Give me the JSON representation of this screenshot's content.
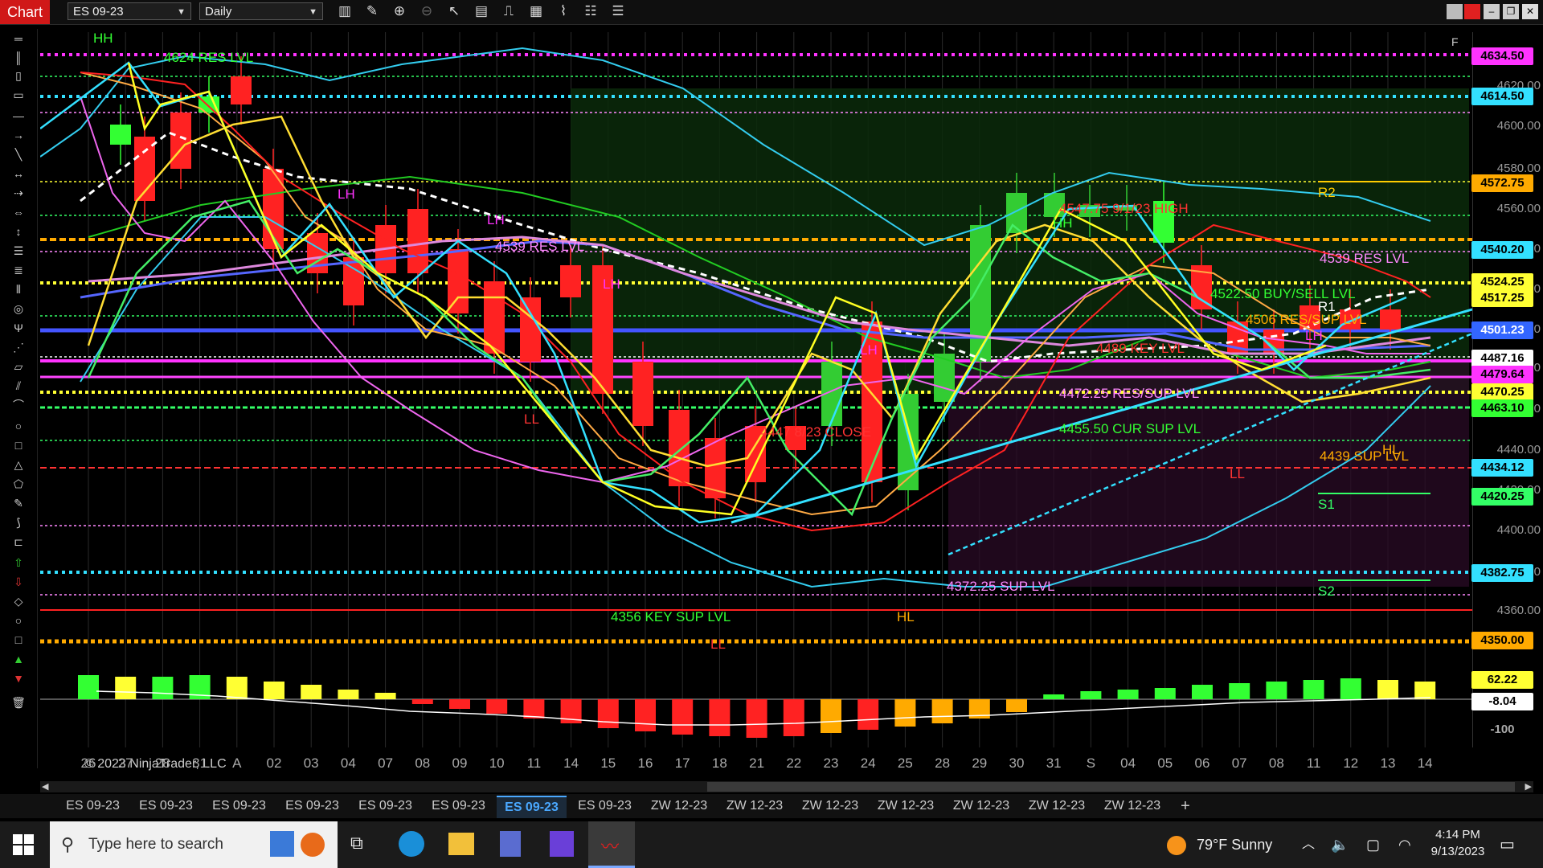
{
  "window": {
    "app_tab": "Chart",
    "instrument": "ES 09-23",
    "interval": "Daily",
    "controls": [
      "minimize",
      "restore",
      "close"
    ]
  },
  "toolbar": {
    "icons": [
      "bars-icon",
      "pencil-icon",
      "zoom-in-icon",
      "zoom-out-icon",
      "pointer-icon",
      "data-box-icon",
      "strategy-icon",
      "indicators-icon",
      "chart-trader-icon",
      "properties-icon",
      "list-icon"
    ]
  },
  "price_axis": {
    "labels": [
      "4620.00",
      "4600.00",
      "4580.00",
      "4560.00",
      "4540.00",
      "4520.00",
      "4500.00",
      "4480.00",
      "4460.00",
      "4440.00",
      "4420.00",
      "4400.00",
      "4380.00",
      "4360.00"
    ],
    "boxes": [
      {
        "text": "4634.50",
        "bg": "#ff33ff"
      },
      {
        "text": "4614.50",
        "bg": "#33e0ff"
      },
      {
        "text": "4572.75",
        "bg": "#ffaa00"
      },
      {
        "text": "4540.20",
        "bg": "#33e0ff"
      },
      {
        "text": "4524.25",
        "bg": "#ffff33"
      },
      {
        "text": "4517.25",
        "bg": "#ffff33"
      },
      {
        "text": "4501.23",
        "bg": "#3366ff"
      },
      {
        "text": "4487.16",
        "bg": "#ffffff"
      },
      {
        "text": "4479.64",
        "bg": "#ff33ff"
      },
      {
        "text": "4470.25",
        "bg": "#ffff33"
      },
      {
        "text": "4463.10",
        "bg": "#33ff33"
      },
      {
        "text": "4434.12",
        "bg": "#33e0ff"
      },
      {
        "text": "4420.25",
        "bg": "#33ff66"
      },
      {
        "text": "4382.75",
        "bg": "#33e0ff"
      },
      {
        "text": "4350.00",
        "bg": "#ffaa00"
      }
    ]
  },
  "oscillator": {
    "labels": [
      "62.22",
      "-8.04",
      "-100"
    ]
  },
  "date_axis": [
    "26",
    "27",
    "28",
    "31",
    "A",
    "02",
    "03",
    "04",
    "07",
    "08",
    "09",
    "10",
    "11",
    "14",
    "15",
    "16",
    "17",
    "18",
    "21",
    "22",
    "23",
    "24",
    "25",
    "28",
    "29",
    "30",
    "31",
    "S",
    "04",
    "05",
    "06",
    "07",
    "08",
    "11",
    "12",
    "13",
    "14"
  ],
  "annotations": [
    {
      "text": "4624 RES LVL",
      "color": "#33ff33"
    },
    {
      "text": "HH",
      "color": "#33ff33"
    },
    {
      "text": "LH",
      "color": "#ff33ff"
    },
    {
      "text": "LH",
      "color": "#ff33ff"
    },
    {
      "text": "4539 RES LVL",
      "color": "#ff88ff"
    },
    {
      "text": "LH",
      "color": "#ff33ff"
    },
    {
      "text": "LL",
      "color": "#ff3333"
    },
    {
      "text": "4447 8/23 CLOSE",
      "color": "#ff3333"
    },
    {
      "text": "LH",
      "color": "#ff33ff"
    },
    {
      "text": "4356 KEY SUP LVL",
      "color": "#33ff33"
    },
    {
      "text": "LL",
      "color": "#ff3333"
    },
    {
      "text": "HL",
      "color": "#ffaa00"
    },
    {
      "text": "4372.25 SUP LVL",
      "color": "#ff88ff"
    },
    {
      "text": "4547.75 9/1/23 HIGH",
      "color": "#ff3333"
    },
    {
      "text": "HH",
      "color": "#33ff33"
    },
    {
      "text": "4522.50 BUY/SELL LVL",
      "color": "#33ff33"
    },
    {
      "text": "4506 RES/SUP LVL",
      "color": "#ffaa00"
    },
    {
      "text": "4489 KEY LVL",
      "color": "#ff3333"
    },
    {
      "text": "4472.25 RES/SUP LVL",
      "color": "#ff88ff"
    },
    {
      "text": "4455.50 CUR SUP LVL",
      "color": "#33ff33"
    },
    {
      "text": "4439 SUP LVL",
      "color": "#ffaa00"
    },
    {
      "text": "4539 RES LVL",
      "color": "#ff88ff"
    },
    {
      "text": "LH",
      "color": "#ff33ff"
    },
    {
      "text": "LL",
      "color": "#ff3333"
    },
    {
      "text": "HL",
      "color": "#ffaa00"
    },
    {
      "text": "R2",
      "color": "#ffcc00"
    },
    {
      "text": "R1",
      "color": "#ffffff"
    },
    {
      "text": "S1",
      "color": "#33ff66"
    },
    {
      "text": "S2",
      "color": "#33ff66"
    },
    {
      "text": "F",
      "color": "#cccccc"
    }
  ],
  "copyright": "© 2023 NinjaTrader, LLC",
  "instrument_tabs": [
    {
      "label": "ES 09-23",
      "active": false
    },
    {
      "label": "ES 09-23",
      "active": false
    },
    {
      "label": "ES 09-23",
      "active": false
    },
    {
      "label": "ES 09-23",
      "active": false
    },
    {
      "label": "ES 09-23",
      "active": false
    },
    {
      "label": "ES 09-23",
      "active": false
    },
    {
      "label": "ES 09-23",
      "active": true
    },
    {
      "label": "ES 09-23",
      "active": false
    },
    {
      "label": "ZW 12-23",
      "active": false
    },
    {
      "label": "ZW 12-23",
      "active": false
    },
    {
      "label": "ZW 12-23",
      "active": false
    },
    {
      "label": "ZW 12-23",
      "active": false
    },
    {
      "label": "ZW 12-23",
      "active": false
    },
    {
      "label": "ZW 12-23",
      "active": false
    },
    {
      "label": "ZW 12-23",
      "active": false
    }
  ],
  "add_tab": "+",
  "taskbar": {
    "search_placeholder": "Type here to search",
    "weather": "79°F  Sunny",
    "time": "4:14 PM",
    "date": "9/13/2023"
  }
}
